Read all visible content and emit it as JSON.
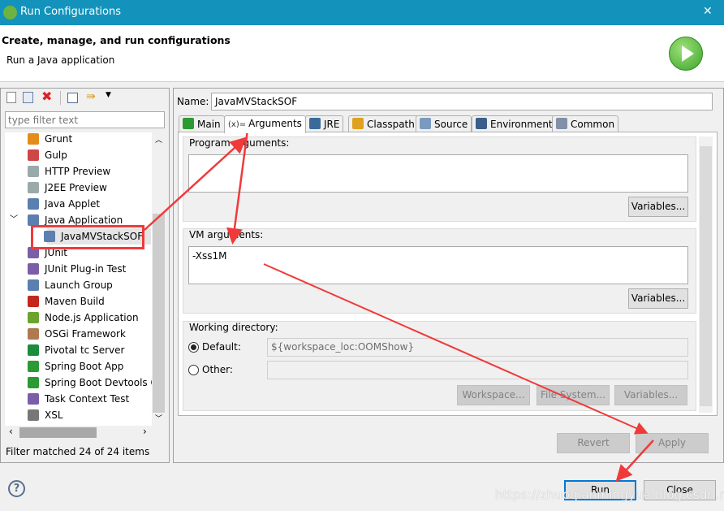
{
  "window": {
    "title": "Run Configurations",
    "close_glyph": "✕"
  },
  "header": {
    "title": "Create, manage, and run configurations",
    "subtitle": "Run a Java application",
    "run_icon": "play-icon"
  },
  "left": {
    "filter_placeholder": "type filter text",
    "tree": [
      {
        "label": "Grunt",
        "icon": "grunt-icon",
        "color": "#e48b1c"
      },
      {
        "label": "Gulp",
        "icon": "gulp-icon",
        "color": "#cf4647"
      },
      {
        "label": "HTTP Preview",
        "icon": "server-icon",
        "color": "#9aa"
      },
      {
        "label": "J2EE Preview",
        "icon": "server-icon",
        "color": "#9aa"
      },
      {
        "label": "Java Applet",
        "icon": "applet-icon",
        "color": "#5a7fb0"
      },
      {
        "label": "Java Application",
        "icon": "java-app-icon",
        "color": "#5a7fb0",
        "expanded": true
      },
      {
        "label": "JavaMVStackSOF",
        "icon": "java-app-icon",
        "color": "#5a7fb0",
        "child": true,
        "selected": true
      },
      {
        "label": "JUnit",
        "icon": "junit-icon",
        "color": "#7a5ea8"
      },
      {
        "label": "JUnit Plug-in Test",
        "icon": "junit-icon",
        "color": "#7a5ea8"
      },
      {
        "label": "Launch Group",
        "icon": "launch-group-icon",
        "color": "#5a7fb0"
      },
      {
        "label": "Maven Build",
        "icon": "maven-icon",
        "color": "#c2281d"
      },
      {
        "label": "Node.js Application",
        "icon": "nodejs-icon",
        "color": "#6ca32d"
      },
      {
        "label": "OSGi Framework",
        "icon": "osgi-icon",
        "color": "#b07a50"
      },
      {
        "label": "Pivotal tc Server",
        "icon": "pivotal-icon",
        "color": "#1b8b3d"
      },
      {
        "label": "Spring Boot App",
        "icon": "spring-boot-icon",
        "color": "#2b9a32"
      },
      {
        "label": "Spring Boot Devtools C",
        "icon": "spring-devtools-icon",
        "color": "#2b9a32"
      },
      {
        "label": "Task Context Test",
        "icon": "junit-icon",
        "color": "#7a5ea8"
      },
      {
        "label": "XSL",
        "icon": "xsl-icon",
        "color": "#777"
      }
    ],
    "status": "Filter matched 24 of 24 items"
  },
  "form": {
    "name_label": "Name:",
    "name_value": "JavaMVStackSOF",
    "tabs": [
      {
        "label": "Main",
        "icon": "main-icon",
        "color": "#2b9a32"
      },
      {
        "label": "Arguments",
        "icon": "arguments-icon",
        "prefix": "(x)=",
        "active": true
      },
      {
        "label": "JRE",
        "icon": "jre-icon",
        "color": "#3a6a9a"
      },
      {
        "label": "Classpath",
        "icon": "classpath-icon",
        "color": "#e0a020"
      },
      {
        "label": "Source",
        "icon": "source-icon",
        "color": "#7a9ac0"
      },
      {
        "label": "Environment",
        "icon": "environment-icon",
        "color": "#3a5e8c"
      },
      {
        "label": "Common",
        "icon": "common-icon",
        "color": "#8090a8"
      }
    ],
    "program_args_label": "Program arguments:",
    "program_args_value": "",
    "vm_args_label": "VM arguments:",
    "vm_args_value": "-Xss1M",
    "variables": "Variables...",
    "working_dir_label": "Working directory:",
    "default_label": "Default:",
    "default_value": "${workspace_loc:OOMShow}",
    "other_label": "Other:",
    "other_value": "",
    "workspace_btn": "Workspace...",
    "filesystem_btn": "File System...",
    "variables_btn": "Variables..."
  },
  "buttons": {
    "revert": "Revert",
    "apply": "Apply",
    "run": "Run",
    "close": "Close"
  },
  "watermark": "https://zhuoqianmingyue.blog.csdn.net",
  "annotation_color": "#f03a3a"
}
